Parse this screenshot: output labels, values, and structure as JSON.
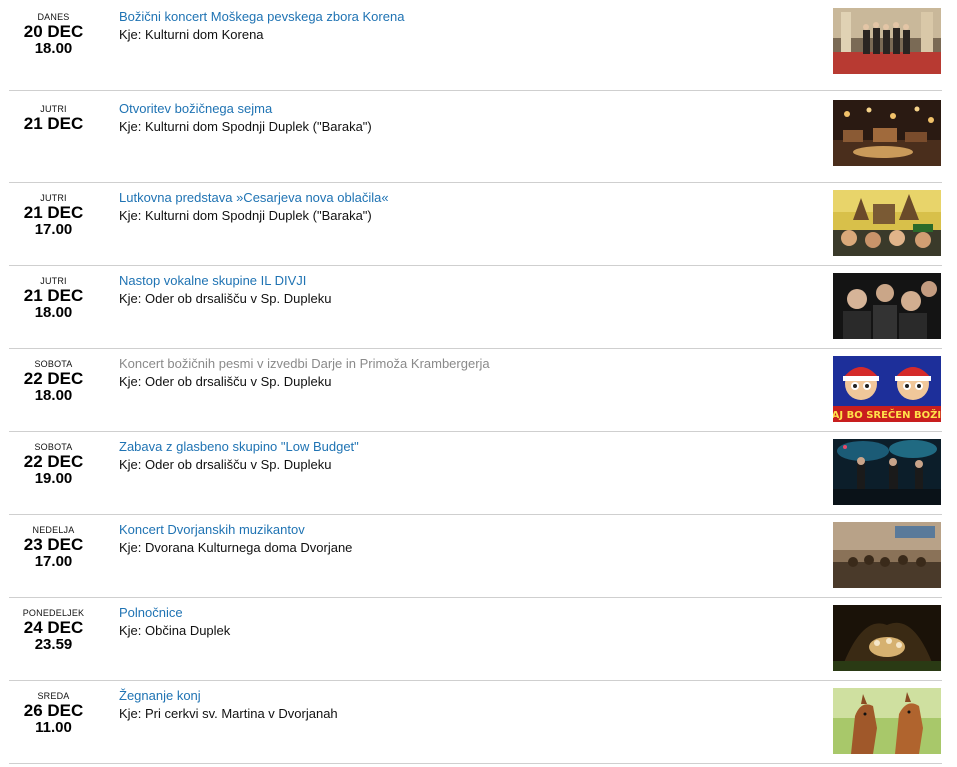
{
  "events": [
    {
      "dow": "DANES",
      "day": "20 DEC",
      "time": "18.00",
      "title": "Božični koncert Moškega pevskega zbora Korena",
      "location": "Kje: Kulturni dom Korena",
      "image": "choir-photo",
      "title_muted": false
    },
    {
      "dow": "JUTRI",
      "day": "21 DEC",
      "time": "",
      "title": "Otvoritev božičnega sejma",
      "location": "Kje: Kulturni dom Spodnji Duplek (\"Baraka\")",
      "image": "market-photo",
      "title_muted": false
    },
    {
      "dow": "JUTRI",
      "day": "21 DEC",
      "time": "17.00",
      "title": "Lutkovna predstava »Cesarjeva nova oblačila«",
      "location": "Kje: Kulturni dom Spodnji Duplek (\"Baraka\")",
      "image": "puppet-show-photo",
      "title_muted": false
    },
    {
      "dow": "JUTRI",
      "day": "21 DEC",
      "time": "18.00",
      "title": "Nastop vokalne skupine IL DIVJI",
      "location": "Kje: Oder ob drsališču v Sp. Dupleku",
      "image": "vocal-group-photo",
      "title_muted": false
    },
    {
      "dow": "SOBOTA",
      "day": "22 DEC",
      "time": "18.00",
      "title": "Koncert božičnih pesmi v izvedbi Darje in Primoža Krambergerja",
      "location": "Kje: Oder ob drsališču v Sp. Dupleku",
      "image": "cartoon-poster",
      "title_muted": true
    },
    {
      "dow": "SOBOTA",
      "day": "22 DEC",
      "time": "19.00",
      "title": "Zabava z glasbeno skupino \"Low Budget\"",
      "location": "Kje: Oder ob drsališču v Sp. Dupleku",
      "image": "band-stage-photo",
      "title_muted": false
    },
    {
      "dow": "NEDELJA",
      "day": "23 DEC",
      "time": "17.00",
      "title": "Koncert Dvorjanskih muzikantov",
      "location": "Kje: Dvorana Kulturnega doma Dvorjane",
      "image": "hall-concert-photo",
      "title_muted": false
    },
    {
      "dow": "PONEDELJEK",
      "day": "24 DEC",
      "time": "23.59",
      "title": "Polnočnice",
      "location": "Kje: Občina Duplek",
      "image": "nativity-photo",
      "title_muted": false
    },
    {
      "dow": "SREDA",
      "day": "26 DEC",
      "time": "11.00",
      "title": "Žegnanje konj",
      "location": "Kje: Pri cerkvi sv. Martina v Dvorjanah",
      "image": "horses-photo",
      "title_muted": false
    }
  ],
  "poster_text": "TAJ BO SREČEN BOŽIČ"
}
